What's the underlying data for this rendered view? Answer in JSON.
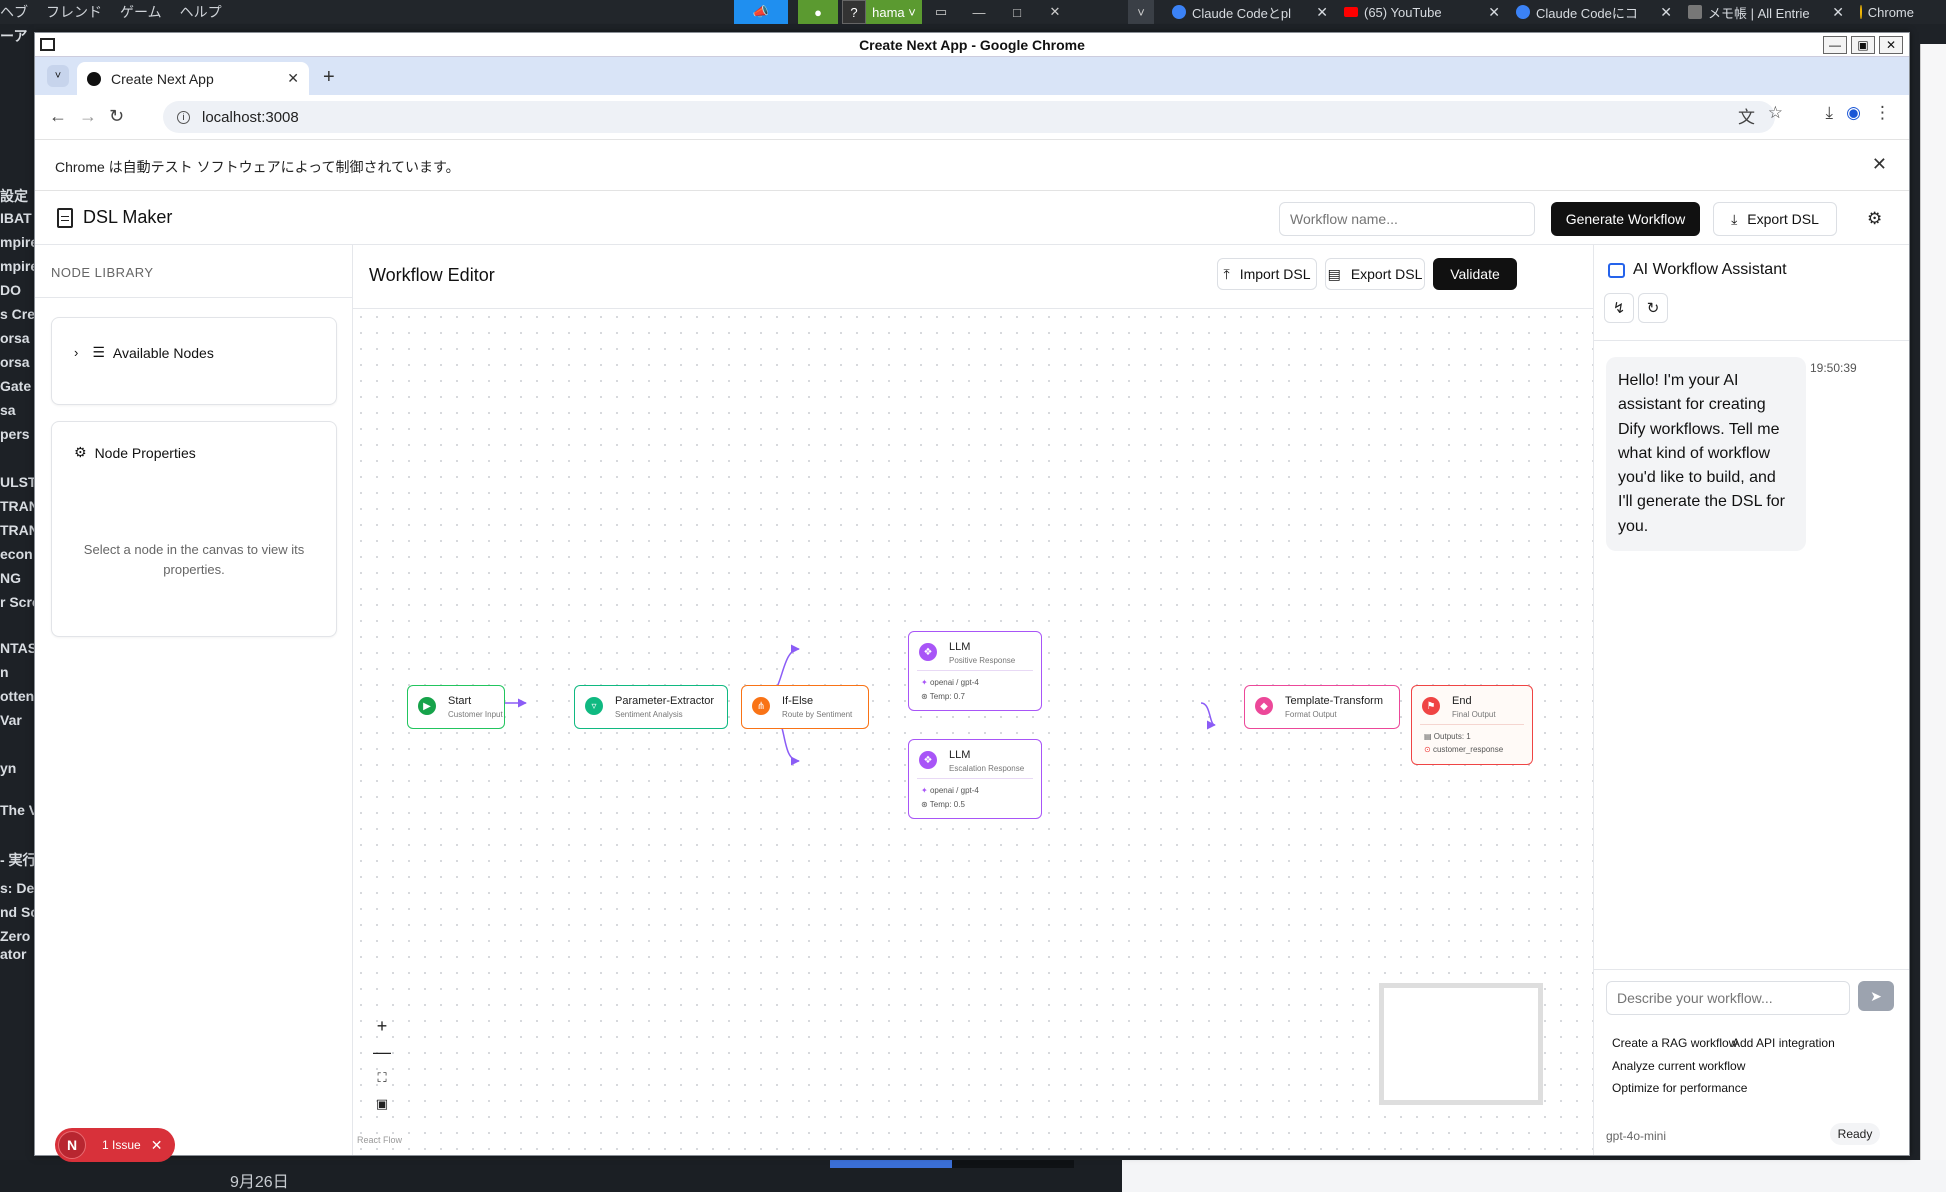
{
  "desktop": {
    "menu": [
      "ヘブ",
      "フレンド",
      "ゲーム",
      "ヘルプ"
    ],
    "tray_user": "hama",
    "tabs": [
      {
        "label": "Claude Codeとpl",
        "fav": "#3b82f6"
      },
      {
        "label": "(65) YouTube",
        "fav": "#ff0000"
      },
      {
        "label": "Claude Codeにコ",
        "fav": "#3b82f6"
      },
      {
        "label": "メモ帳 | All Entrie",
        "fav": "#777777"
      },
      {
        "label": "Chrome",
        "fav": "#f2b705"
      }
    ],
    "left_fragments": [
      "ーア",
      "設定",
      "IBAT",
      "mpire",
      "mpire",
      "DO",
      "s Cre",
      "orsa",
      "orsa",
      "Gate",
      "sa",
      "pers",
      "ULST",
      "TRAN",
      "TRAN",
      "econ",
      "NG",
      "r Scro",
      "NTAS",
      "n",
      "otten",
      "Var",
      "yn",
      "The V",
      "- 実行",
      "s: De",
      "nd Sc",
      "Zero Dawn",
      "ator"
    ],
    "bottom_date": "9月26日"
  },
  "window": {
    "title": "Create Next App - Google Chrome",
    "tab_title": "Create Next App",
    "url": "localhost:3008",
    "infobar": "Chrome は自動テスト ソフトウェアによって制御されています。"
  },
  "app": {
    "brand": "DSL Maker",
    "workflow_name_placeholder": "Workflow name...",
    "generate_label": "Generate Workflow",
    "export_label": "Export DSL"
  },
  "sidebar": {
    "heading": "NODE LIBRARY",
    "available_nodes": "Available Nodes",
    "node_properties": "Node Properties",
    "empty_text": "Select a node in the canvas to view its properties.",
    "issue_badge": "N",
    "issue_text": "1 Issue"
  },
  "editor": {
    "title": "Workflow Editor",
    "import_label": "Import DSL",
    "export_label": "Export DSL",
    "validate_label": "Validate",
    "react_flow_label": "React Flow",
    "nodes": {
      "start": {
        "title": "Start",
        "subtitle": "Customer Input"
      },
      "param": {
        "title": "Parameter-Extractor",
        "subtitle": "Sentiment Analysis"
      },
      "ifelse": {
        "title": "If-Else",
        "subtitle": "Route by Sentiment"
      },
      "llm1": {
        "title": "LLM",
        "subtitle": "Positive Response",
        "model": "openai / gpt-4",
        "temp": "Temp: 0.7"
      },
      "llm2": {
        "title": "LLM",
        "subtitle": "Escalation Response",
        "model": "openai / gpt-4",
        "temp": "Temp: 0.5"
      },
      "template": {
        "title": "Template-Transform",
        "subtitle": "Format Output"
      },
      "end": {
        "title": "End",
        "subtitle": "Final Output",
        "outputs": "Outputs: 1",
        "output_var": "customer_response"
      }
    },
    "colors": {
      "start": "#22c55e",
      "param": "#10b981",
      "ifelse": "#f97316",
      "llm": "#a855f7",
      "template": "#ec4899",
      "end": "#ef4444",
      "edge": "#8b5cf6"
    }
  },
  "assistant": {
    "title": "AI Workflow Assistant",
    "message": "Hello! I'm your AI assistant for creating Dify workflows. Tell me what kind of workflow you'd like to build, and I'll generate the DSL for you.",
    "time": "19:50:39",
    "input_placeholder": "Describe your workflow...",
    "suggestions": [
      "Create a RAG workflow",
      "Add API integration",
      "Analyze current workflow",
      "Optimize for performance"
    ],
    "model": "gpt-4o-mini",
    "status": "Ready"
  }
}
